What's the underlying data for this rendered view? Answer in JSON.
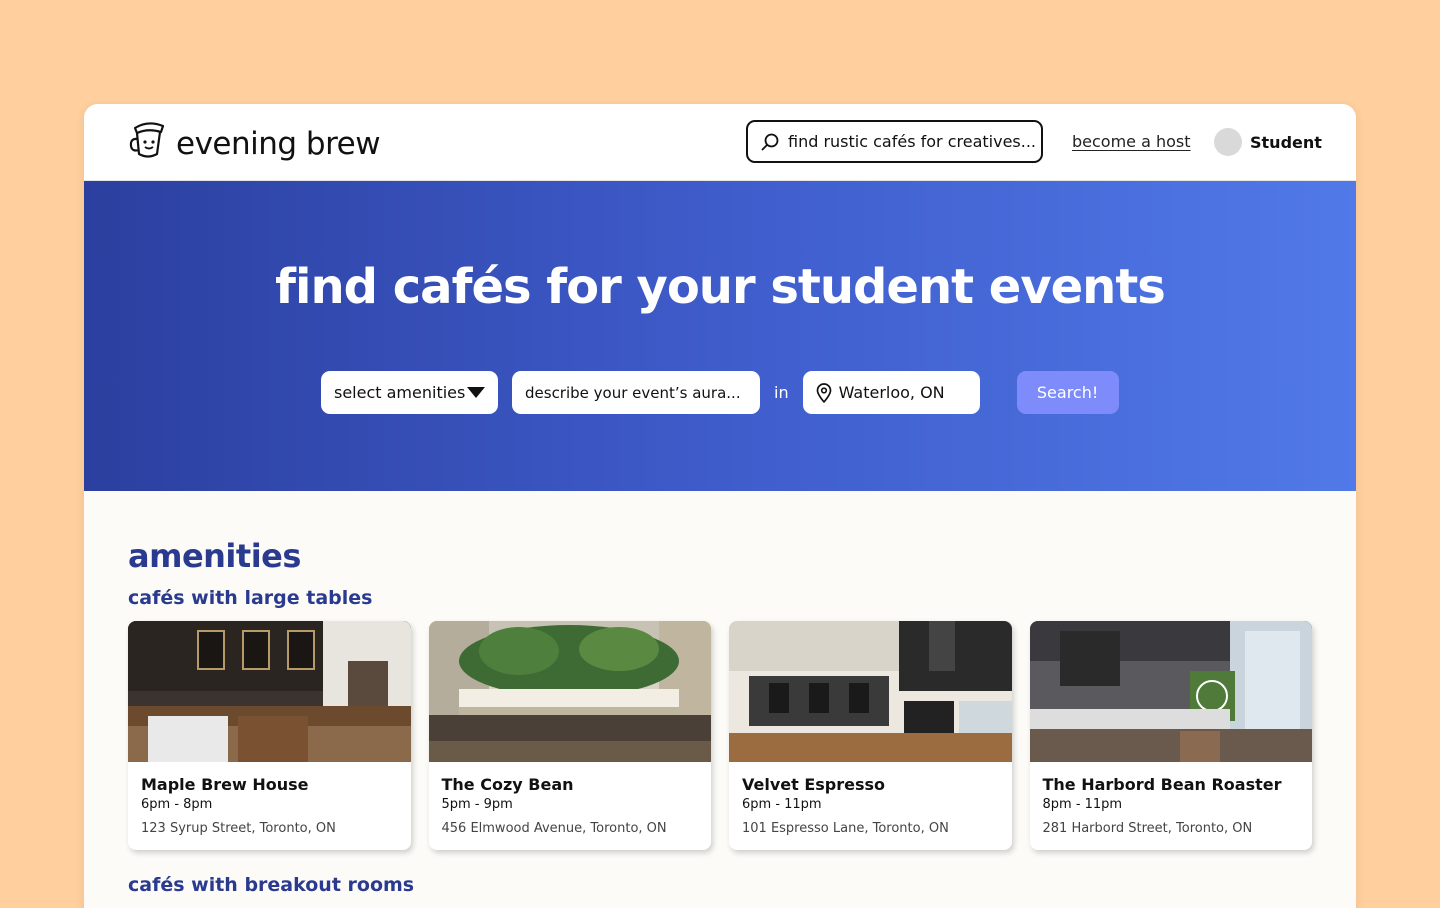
{
  "brand": {
    "name": "evening brew"
  },
  "header": {
    "search_placeholder": "find rustic cafés for creatives...",
    "host_link": "become a host",
    "user_name": "Student"
  },
  "hero": {
    "title": "find cafés for your student events",
    "amenities_label": "select amenities",
    "aura_placeholder": "describe your event’s aura...",
    "in_label": "in",
    "location": "Waterloo, ON",
    "search_button": "Search!"
  },
  "main": {
    "section_title": "amenities",
    "groups": [
      {
        "title": "cafés with large tables",
        "cafes": [
          {
            "name": "Maple Brew House",
            "hours": "6pm - 8pm",
            "address": "123 Syrup Street, Toronto, ON"
          },
          {
            "name": "The Cozy Bean",
            "hours": "5pm - 9pm",
            "address": "456 Elmwood Avenue, Toronto, ON"
          },
          {
            "name": "Velvet Espresso",
            "hours": "6pm - 11pm",
            "address": "101 Espresso Lane, Toronto, ON"
          },
          {
            "name": "The Harbord Bean Roaster",
            "hours": "8pm - 11pm",
            "address": "281 Harbord Street, Toronto, ON"
          }
        ]
      },
      {
        "title": "cafés with breakout rooms"
      }
    ]
  },
  "colors": {
    "background": "#FFD09E",
    "hero_start": "#2B3F9F",
    "hero_end": "#5179E8",
    "accent_button": "#7E8BFA",
    "heading": "#2A3A8F"
  },
  "icons": [
    "coffee-cup-logo-icon",
    "search-icon",
    "dropdown-triangle-icon",
    "location-pin-icon"
  ]
}
